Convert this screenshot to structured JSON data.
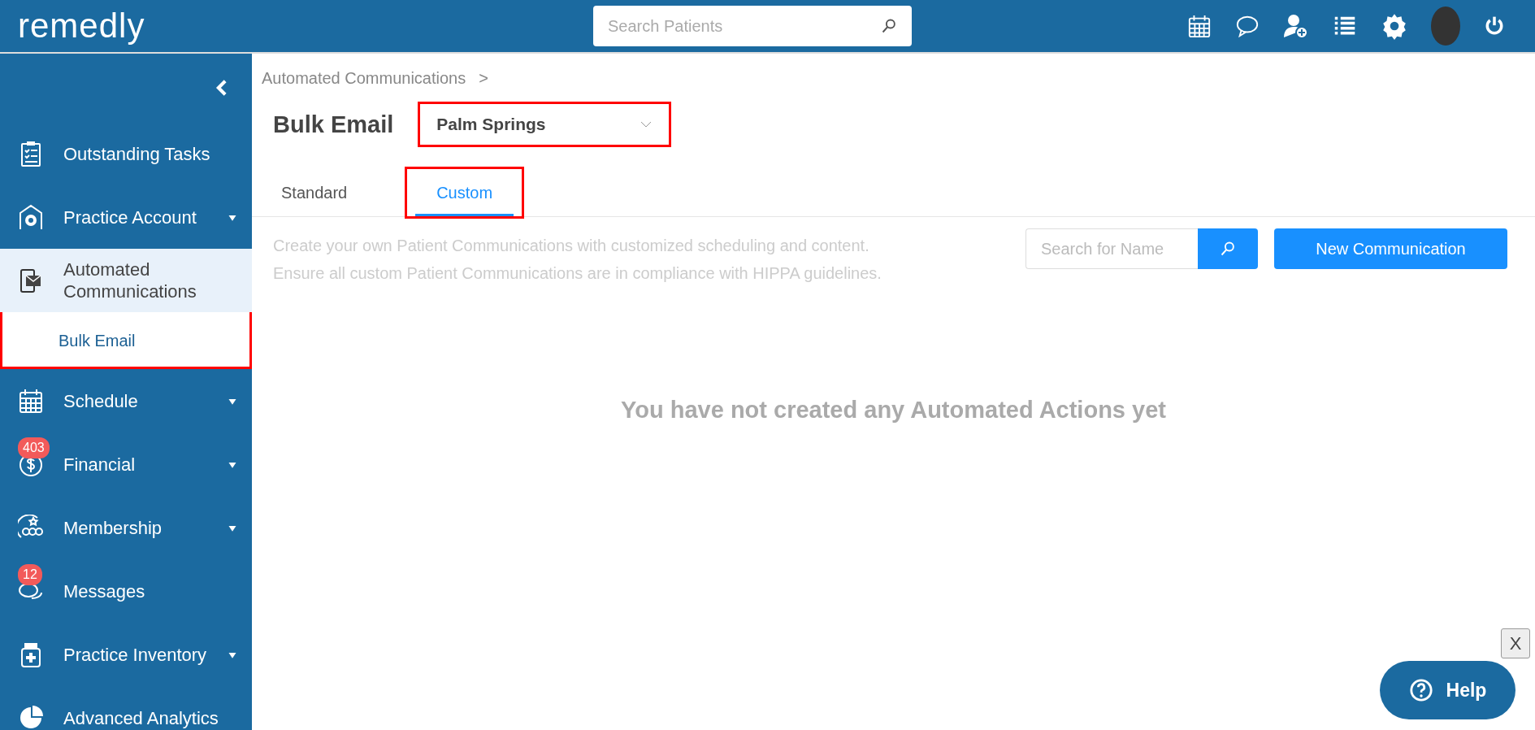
{
  "topbar": {
    "logo": "remedly",
    "search": {
      "placeholder": "Search Patients"
    }
  },
  "sidebar": {
    "items": [
      {
        "label": "Outstanding Tasks",
        "dropdown": false,
        "selected": false,
        "highlighted": false
      },
      {
        "label": "Practice Account",
        "dropdown": true,
        "selected": false,
        "highlighted": false
      },
      {
        "label": "Automated Communications",
        "dropdown": false,
        "selected": true,
        "highlighted": true,
        "children": [
          {
            "label": "Bulk Email",
            "selected": true
          }
        ]
      },
      {
        "label": "Schedule",
        "dropdown": true,
        "selected": false,
        "highlighted": false
      },
      {
        "label": "Financial",
        "dropdown": true,
        "selected": false,
        "highlighted": false,
        "badge": "403"
      },
      {
        "label": "Membership",
        "dropdown": true,
        "selected": false,
        "highlighted": false
      },
      {
        "label": "Messages",
        "dropdown": false,
        "selected": false,
        "highlighted": false,
        "badge": "12"
      },
      {
        "label": "Practice Inventory",
        "dropdown": true,
        "selected": false,
        "highlighted": false
      },
      {
        "label": "Advanced Analytics",
        "dropdown": false,
        "selected": false,
        "highlighted": false
      }
    ]
  },
  "breadcrumb": {
    "items": [
      "Automated Communications"
    ],
    "separator": ">"
  },
  "page_title": "Bulk Email",
  "location_select": {
    "value": "Palm Springs",
    "highlighted": true
  },
  "tabs": [
    {
      "label": "Standard",
      "selected": false,
      "highlighted": false
    },
    {
      "label": "Custom",
      "selected": true,
      "highlighted": true
    }
  ],
  "description": [
    "Create your own Patient Communications with customized scheduling and content.",
    "Ensure all custom Patient Communications are in compliance with HIPPA guidelines."
  ],
  "name_search": {
    "placeholder": "Search for Name"
  },
  "new_button": "New Communication",
  "empty_message": "You have not created any Automated Actions yet",
  "close_button": "X",
  "help_button": "Help"
}
